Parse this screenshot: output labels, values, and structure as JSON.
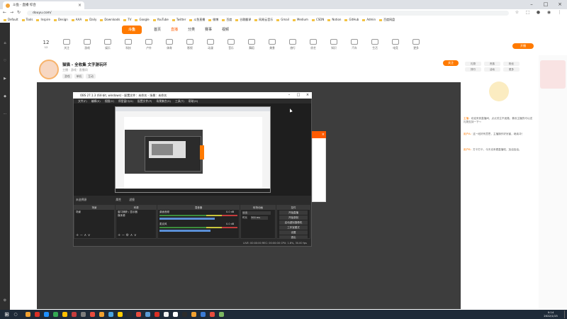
{
  "browser": {
    "tab_title": "斗鱼 - 直播 综合",
    "url": "douyu.com/",
    "bookmarks": [
      "Default",
      "Tools",
      "Inspire",
      "Design",
      "AAA",
      "Daily",
      "Downloads",
      "TV",
      "Google",
      "YouTube",
      "Twitter",
      "斗鱼直播",
      "微博",
      "百度",
      "谷歌翻译",
      "网易云音乐",
      "Gmail",
      "Medium",
      "CSDN",
      "Notion",
      "GitHub",
      "Admin",
      "百度网盘"
    ]
  },
  "site": {
    "logo": "斗鱼",
    "nav": [
      "首页",
      "直播",
      "分类",
      "赛事",
      "视频"
    ],
    "categories": [
      "12",
      "关注",
      "游戏",
      "娱乐",
      "科技",
      "户外",
      "体育",
      "影视",
      "动漫",
      "音乐",
      "舞蹈",
      "美食",
      "旅行",
      "综艺",
      "知识",
      "汽车",
      "生活",
      "电竞",
      "更多"
    ],
    "cat_big_number": "12",
    "right_button": "开播",
    "streamer_name": "猫猫 - 全收集 文字游玩环",
    "streamer_sub": "主播 · 游戏 · 直播间",
    "tags": [
      "游戏",
      "单机",
      "互动"
    ],
    "follow_label": "关注",
    "sidebar_buttons": [
      "礼物",
      "贵族",
      "粉丝",
      "排行",
      "活动",
      "更多"
    ],
    "chat": [
      {
        "user": "主播：",
        "text": "欢迎来到直播间，点点关注不迷路，喜欢主播的可以送礼物支持一下～"
      },
      {
        "user": "用户A：",
        "text": "这一段好有意思，主播操作好厉害，继续冲！"
      },
      {
        "user": "用户B：",
        "text": "打卡打卡，今天也来看直播啦，加油加油。"
      }
    ]
  },
  "obs": {
    "title": "OBS 27.1.3 (64-bit, windows) - 配置文件：未命名 - 场景：未命名",
    "menu": [
      "文件(F)",
      "编辑(E)",
      "视图(V)",
      "停靠窗口(D)",
      "配置文件(P)",
      "场景集合(S)",
      "工具(T)",
      "帮助(H)"
    ],
    "label_bar": "未选择源",
    "label_props": "属性",
    "label_filters": "滤镜",
    "docks": {
      "scenes": {
        "header": "场景",
        "items": [
          "场景"
        ]
      },
      "sources": {
        "header": "来源",
        "items": [
          "窗口捕获 / 显示器",
          "媒体源"
        ]
      },
      "mixer": {
        "header": "混音器",
        "tracks": [
          {
            "name": "桌面音频",
            "level": "0.0 dB",
            "fill": 0.85
          },
          {
            "name": "麦克风",
            "level": "0.0 dB",
            "fill": 0.78
          }
        ]
      },
      "transitions": {
        "header": "转场动画",
        "type": "淡出",
        "duration_label": "时长",
        "duration": "300 ms"
      },
      "controls": {
        "header": "控件",
        "buttons": [
          "开始直播",
          "开始录制",
          "启动虚拟摄像机",
          "工作室模式",
          "设置",
          "退出"
        ]
      }
    },
    "status": "LIVE: 00:00:00   REC: 00:00:00   CPU: 1.8%, 30.00 fps"
  },
  "taskbar": {
    "time": "0:14",
    "date": "2022/1/15",
    "apps": [
      "#f0a030",
      "#d93025",
      "#1e90ff",
      "#34a853",
      "#ffbf00",
      "#c43c3c",
      "#7c7c7c",
      "#e84c3d",
      "#f0a030",
      "#4aa3df",
      "#ffcc00",
      "#2b2b2b",
      "#e84c3d",
      "#5b9bd5",
      "#d93025",
      "#f0f0f0",
      "#ffffff",
      "#2b2b2b",
      "#f0a030",
      "#3a7bd5",
      "#e84c3d",
      "#7bb661"
    ]
  }
}
